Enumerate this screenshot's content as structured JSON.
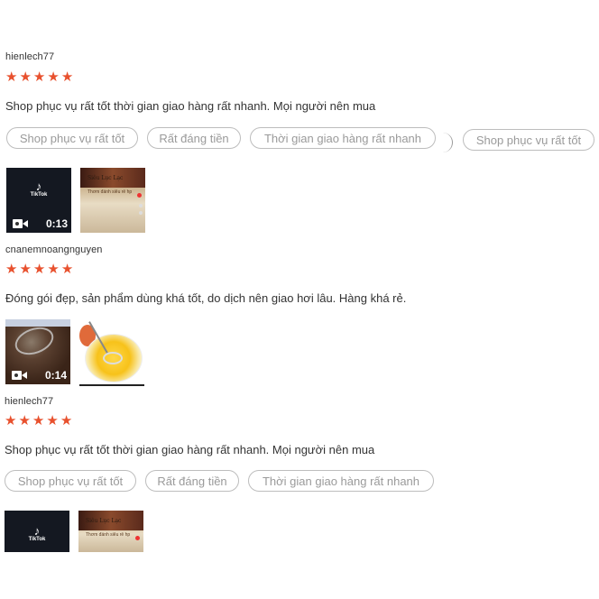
{
  "reviews": [
    {
      "username": "hienlech77",
      "rating": 5,
      "stars": [
        "★",
        "★",
        "★",
        "★",
        "★"
      ],
      "comment": "Shop phục vụ rất tốt thời gian giao hàng rất nhanh. Mọi người nên mua",
      "tags": [
        "Shop phục vụ rất tốt",
        "Rất đáng tiền",
        "Thời gian giao hàng rất nhanh",
        "Shop phục vụ rất tốt"
      ],
      "video": {
        "logo": "TikTok",
        "duration": "0:13"
      },
      "photo": {
        "caption_title": "Siêu Lục Lạc",
        "caption_sub": "Thơm đánh siêu rẻ hp"
      }
    },
    {
      "username": "cnanemnoangnguyen",
      "rating": 5,
      "stars": [
        "★",
        "★",
        "★",
        "★",
        "★"
      ],
      "comment": "Đóng gói đẹp, sản phẩm dùng khá tốt, do dịch nên  giao hơi lâu. Hàng khá rẻ.",
      "video": {
        "duration": "0:14"
      }
    },
    {
      "username": "hienlech77",
      "rating": 5,
      "stars": [
        "★",
        "★",
        "★",
        "★",
        "★"
      ],
      "comment": "Shop phục vụ rất tốt thời gian giao hàng rất nhanh. Mọi người nên mua",
      "tags": [
        "Shop phục vụ rất tốt",
        "Rất đáng tiền",
        "Thời gian giao hàng rất nhanh"
      ],
      "video": {
        "logo": "TikTok"
      },
      "photo": {
        "caption_title": "Siêu Lục Lạc",
        "caption_sub": "Thơm đánh siêu rẻ hp"
      }
    }
  ],
  "icons": {
    "star": "star-icon",
    "camera": "video-camera-icon",
    "tiktok": "tiktok-logo-icon"
  },
  "colors": {
    "star": "#e8512e",
    "tag_border": "#bdbdbd",
    "tag_text": "#9a9a9a"
  }
}
